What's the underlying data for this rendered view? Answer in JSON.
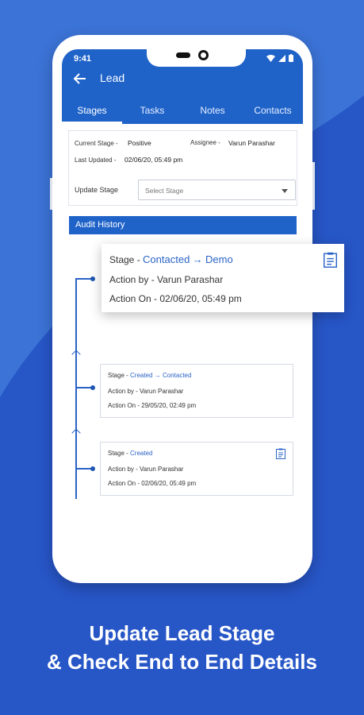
{
  "status_bar": {
    "time": "9:41"
  },
  "app_bar": {
    "title": "Lead"
  },
  "tabs": [
    {
      "label": "Stages",
      "active": true
    },
    {
      "label": "Tasks",
      "active": false
    },
    {
      "label": "Notes",
      "active": false
    },
    {
      "label": "Contacts",
      "active": false
    }
  ],
  "lead_info": {
    "current_stage_label": "Current Stage -",
    "current_stage_value": "Positive",
    "assignee_label": "Assignee -",
    "assignee_value": "Varun Parashar",
    "last_updated_label": "Last Updated -",
    "last_updated_value": "02/06/20, 05:49 pm",
    "update_stage_label": "Update Stage",
    "select_placeholder": "Select Stage"
  },
  "audit": {
    "header": "Audit History",
    "entries": [
      {
        "stage_label": "Stage -",
        "stage_from": "Contacted",
        "arrow": "→",
        "stage_to": "Demo",
        "action_by_label": "Action by -",
        "action_by": "Varun Parashar",
        "action_on_label": "Action On -",
        "action_on": "02/06/20, 05:49 pm"
      },
      {
        "stage_label": "Stage -",
        "stage_from": "Created",
        "arrow": "→",
        "stage_to": "Contacted",
        "action_by_label": "Action by -",
        "action_by": "Varun Parashar",
        "action_on_label": "Action On -",
        "action_on": "29/05/20, 02:49 pm"
      },
      {
        "stage_label": "Stage -",
        "stage_from": "Created",
        "action_by_label": "Action by -",
        "action_by": "Varun Parashar",
        "action_on_label": "Action On -",
        "action_on": "02/06/20, 05:49 pm"
      }
    ]
  },
  "caption": {
    "line1": "Update Lead Stage",
    "line2": "& Check End to End Details"
  },
  "colors": {
    "background": "#2756c7",
    "primary": "#1f63c9",
    "accent_text": "#2a63c7"
  }
}
